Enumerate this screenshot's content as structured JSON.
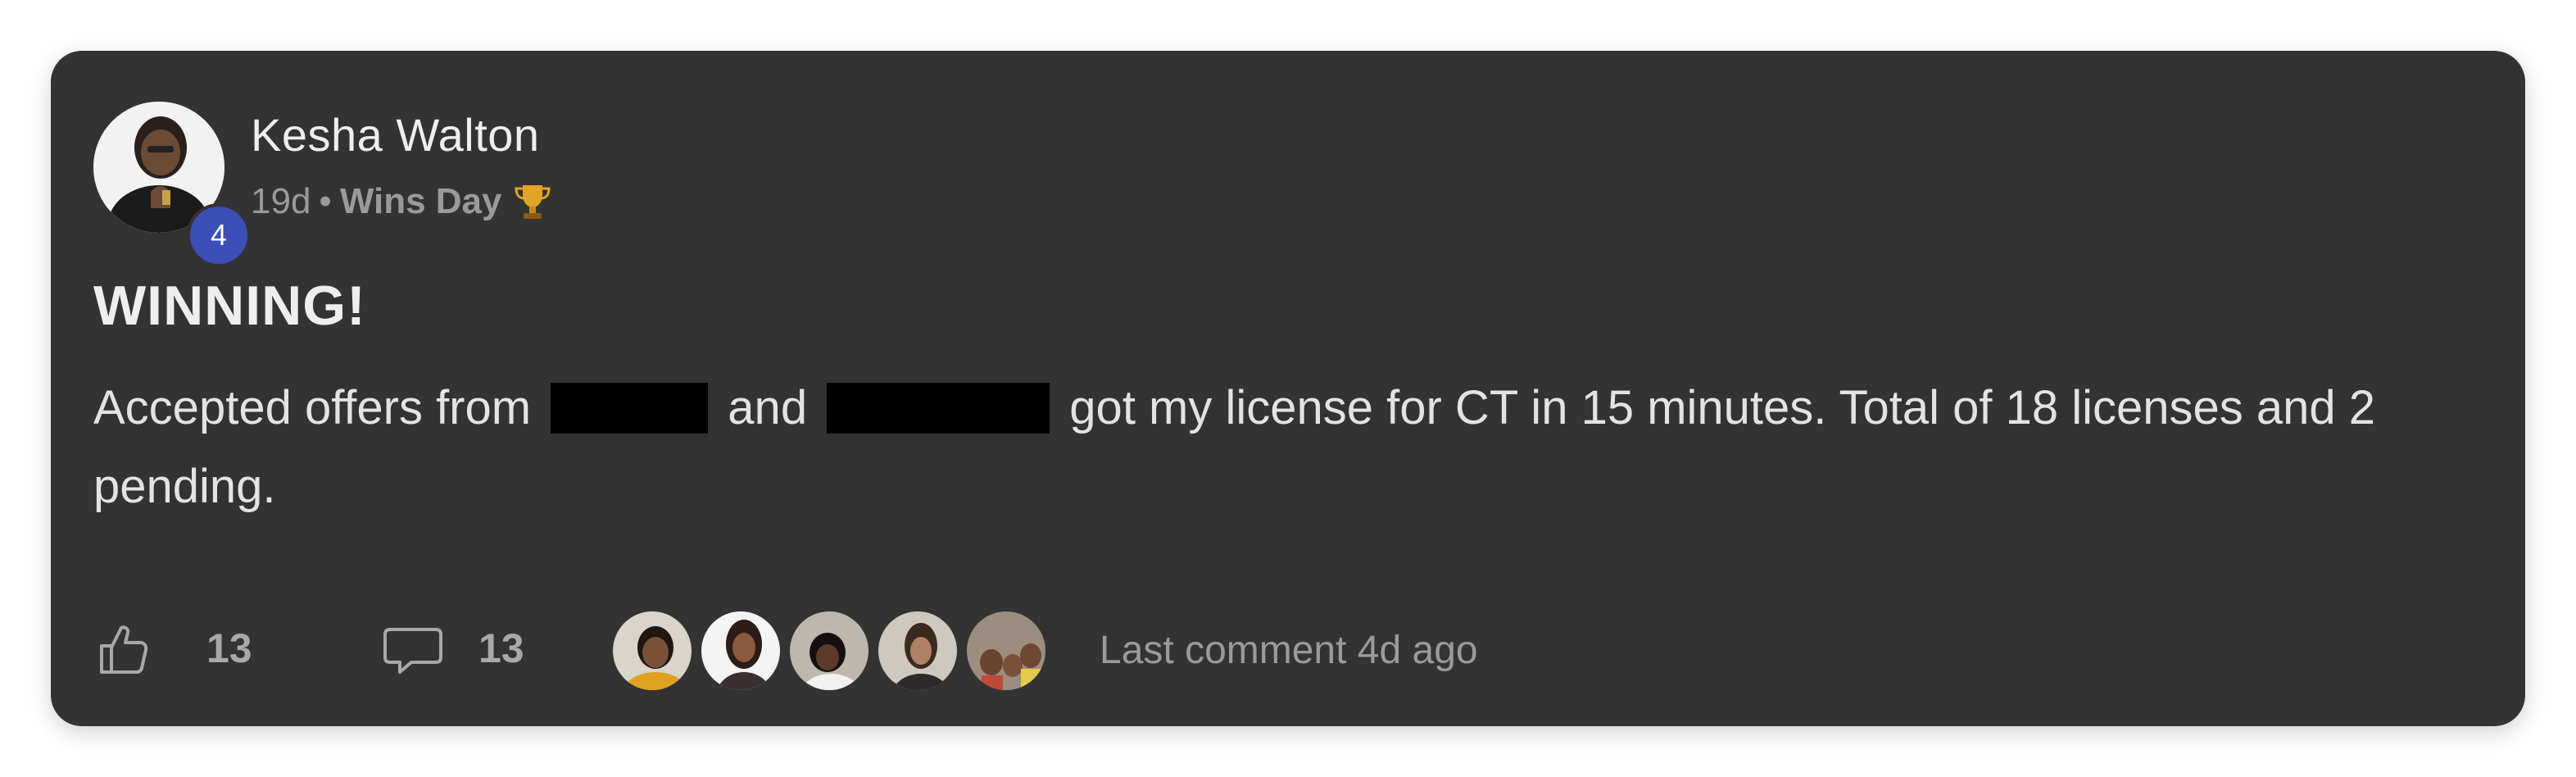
{
  "post": {
    "author": {
      "name": "Kesha Walton",
      "level": "4",
      "avatar_icon": "user-photo-avatar"
    },
    "meta": {
      "age": "19d",
      "separator": "•",
      "category": "Wins Day",
      "category_icon": "trophy-icon"
    },
    "title": "WINNING!",
    "body": {
      "part1": "Accepted offers from",
      "part2": "and",
      "part3": "got my license for CT in 15 minutes. Total of 18 licenses and 2 pending."
    },
    "footer": {
      "likes": "13",
      "comments": "13",
      "last_comment": "Last comment 4d ago",
      "commenter_count": 5
    }
  },
  "colors": {
    "card_background": "#333333",
    "level_badge": "#3c4fb8",
    "redaction": "#000000",
    "muted_text": "#9a9a9a"
  }
}
